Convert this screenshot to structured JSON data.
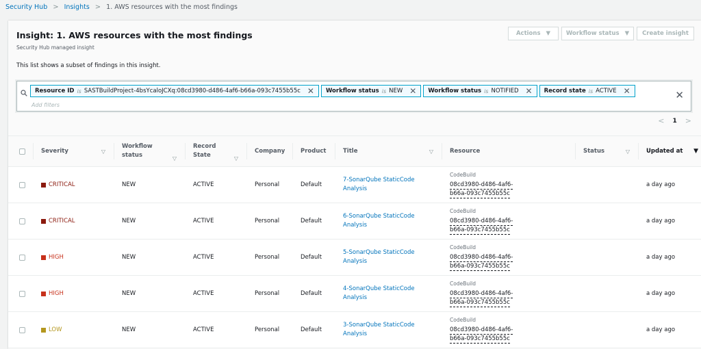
{
  "breadcrumb": [
    "Security Hub",
    "Insights",
    "1. AWS resources with the most findings"
  ],
  "header": {
    "title": "Insight: 1. AWS resources with the most findings",
    "subtitle": "Security Hub managed insight",
    "description": "This list shows a subset of findings in this insight.",
    "actions_label": "Actions",
    "workflow_label": "Workflow status",
    "create_label": "Create insight"
  },
  "filters": {
    "tokens": [
      {
        "key": "Resource ID",
        "op": "is",
        "value": "SASTBuildProject-4bsYcaloJCXq:08cd3980-d486-4af6-b66a-093c7455b55c"
      },
      {
        "key": "Workflow status",
        "op": "is",
        "value": "NEW"
      },
      {
        "key": "Workflow status",
        "op": "is",
        "value": "NOTIFIED"
      },
      {
        "key": "Record state",
        "op": "is",
        "value": "ACTIVE"
      }
    ],
    "placeholder": "Add filters"
  },
  "pagination": {
    "page": "1"
  },
  "table": {
    "columns": {
      "severity": "Severity",
      "workflow1": "Workflow",
      "workflow2": "status",
      "record1": "Record",
      "record2": "State",
      "company": "Company",
      "product": "Product",
      "title": "Title",
      "resource": "Resource",
      "status": "Status",
      "updated": "Updated at"
    },
    "severity_colors": {
      "CRITICAL": "#8b1a0e",
      "HIGH": "#c7311b",
      "LOW": "#b4971f"
    },
    "rows": [
      {
        "severity": "CRITICAL",
        "workflow": "NEW",
        "record": "ACTIVE",
        "company": "Personal",
        "product": "Default",
        "title1": "7-SonarQube StaticCode",
        "title2": "Analysis",
        "res_type": "CodeBuild",
        "res_id1": "08cd3980-d486-4af6-",
        "res_id2": "b66a-093c7455b55c",
        "status": "",
        "updated": "a day ago"
      },
      {
        "severity": "CRITICAL",
        "workflow": "NEW",
        "record": "ACTIVE",
        "company": "Personal",
        "product": "Default",
        "title1": "6-SonarQube StaticCode",
        "title2": "Analysis",
        "res_type": "CodeBuild",
        "res_id1": "08cd3980-d486-4af6-",
        "res_id2": "b66a-093c7455b55c",
        "status": "",
        "updated": "a day ago"
      },
      {
        "severity": "HIGH",
        "workflow": "NEW",
        "record": "ACTIVE",
        "company": "Personal",
        "product": "Default",
        "title1": "5-SonarQube StaticCode",
        "title2": "Analysis",
        "res_type": "CodeBuild",
        "res_id1": "08cd3980-d486-4af6-",
        "res_id2": "b66a-093c7455b55c",
        "status": "",
        "updated": "a day ago"
      },
      {
        "severity": "HIGH",
        "workflow": "NEW",
        "record": "ACTIVE",
        "company": "Personal",
        "product": "Default",
        "title1": "4-SonarQube StaticCode",
        "title2": "Analysis",
        "res_type": "CodeBuild",
        "res_id1": "08cd3980-d486-4af6-",
        "res_id2": "b66a-093c7455b55c",
        "status": "",
        "updated": "a day ago"
      },
      {
        "severity": "LOW",
        "workflow": "NEW",
        "record": "ACTIVE",
        "company": "Personal",
        "product": "Default",
        "title1": "3-SonarQube StaticCode",
        "title2": "Analysis",
        "res_type": "CodeBuild",
        "res_id1": "08cd3980-d486-4af6-",
        "res_id2": "b66a-093c7455b55c",
        "status": "",
        "updated": "a day ago"
      }
    ]
  }
}
